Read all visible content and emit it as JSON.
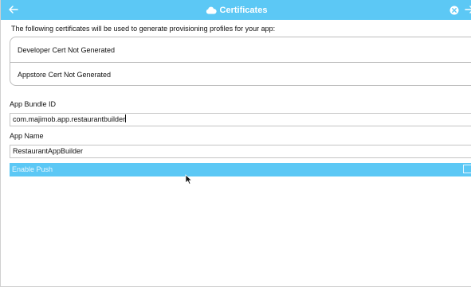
{
  "window": {
    "title": "Certificates",
    "accent_color": "#5cc8f5"
  },
  "titlebar": {
    "back_icon": "arrow-left-icon",
    "title_icon": "cloud-icon",
    "close_icon": "close-circle-icon",
    "forward_icon": "arrow-right-icon"
  },
  "intro_text": "The following certificates will be used to generate provisioning profiles for your app:",
  "certificates": [
    {
      "label": "Developer Cert Not Generated"
    },
    {
      "label": "Appstore Cert Not Generated"
    }
  ],
  "bundle": {
    "label": "App Bundle ID",
    "value": "com.majimob.app.restaurantbuilder"
  },
  "app_name": {
    "label": "App Name",
    "value": "RestaurantAppBuilder"
  },
  "push": {
    "label": "Enable Push",
    "checked": false
  }
}
